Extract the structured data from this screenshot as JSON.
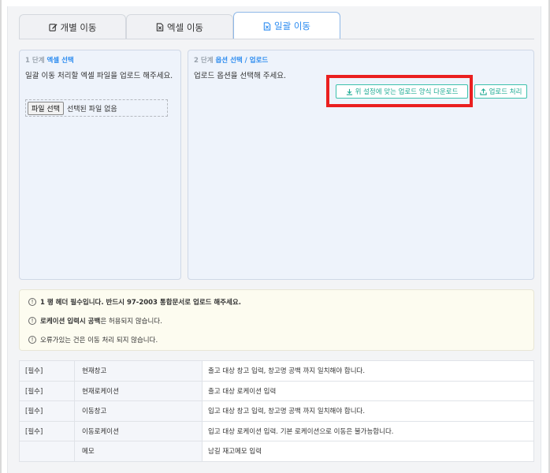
{
  "tabs": [
    {
      "label": "개별 이동",
      "icon": "edit-icon"
    },
    {
      "label": "엑셀 이동",
      "icon": "excel-file-icon"
    },
    {
      "label": "일괄 이동",
      "icon": "excel-file-icon",
      "active": true
    }
  ],
  "step1": {
    "prefix": "1 단계",
    "title": "엑셀 선택",
    "desc": "일괄 이동 처리할 엑셀 파일을 업로드 해주세요.",
    "file_button": "파일 선택",
    "file_status": "선택된 파일 없음"
  },
  "step2": {
    "prefix": "2 단계",
    "title": "옵션 선택 / 업로드",
    "desc": "업로드 옵션을 선택해 주세요.",
    "download_button": "위 설정에 맞는 업로드 양식 다운로드",
    "upload_button": "업로드 처리"
  },
  "notes": [
    {
      "bold": "1 행 헤더 필수입니다. 반드시 97-2003 통합문서로 업로드 해주세요.",
      "rest": ""
    },
    {
      "bold": "로케이션 입력시 공백",
      "rest": "은 허용되지 않습니다."
    },
    {
      "bold": "",
      "rest": "오류가있는 건은 이동 처리 되지 않습니다."
    }
  ],
  "requirements": [
    {
      "req": "[필수]",
      "field": "현재창고",
      "desc": "출고 대상 창고 입력, 창고명 공백 까지 일치해야 합니다."
    },
    {
      "req": "[필수]",
      "field": "현재로케이션",
      "desc": "출고 대상 로케이션 입력"
    },
    {
      "req": "[필수]",
      "field": "이동창고",
      "desc": "입고 대상 창고 입력, 창고명 공백 까지 일치해야 합니다."
    },
    {
      "req": "[필수]",
      "field": "이동로케이션",
      "desc": "입고 대상 로케이션 입력. 기본 로케이션으로 이동은 불가능합니다."
    },
    {
      "req": "",
      "field": "메모",
      "desc": "남길 재고메모 입력"
    }
  ],
  "colors": {
    "accent": "#2d8cf0",
    "teal": "#1eab94",
    "highlight": "#ea1f1f"
  }
}
